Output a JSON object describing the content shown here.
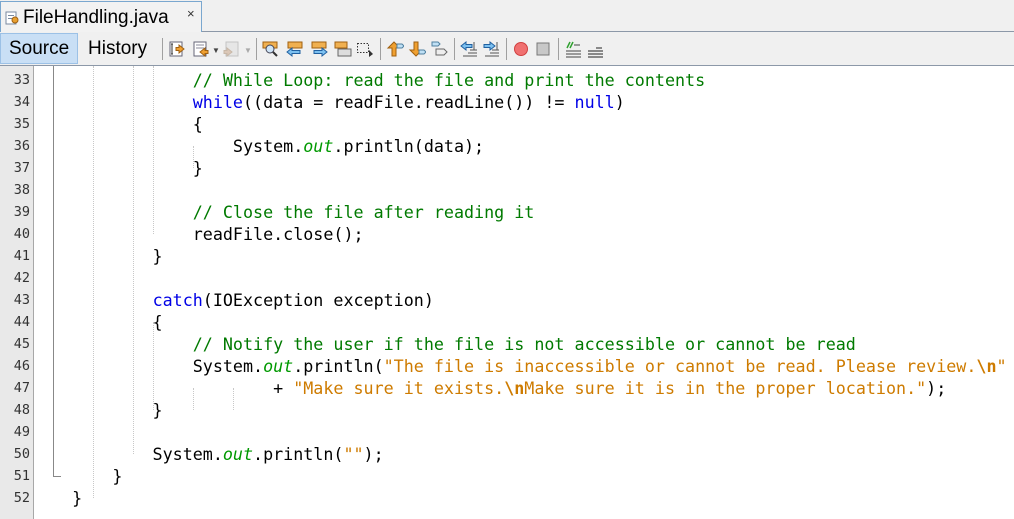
{
  "file_tab": {
    "name": "FileHandling.java",
    "close": "×",
    "icon": "java-file-icon"
  },
  "view_tabs": [
    {
      "label": "Source",
      "active": true
    },
    {
      "label": "History",
      "active": false
    }
  ],
  "toolbar": {
    "icons": [
      "last-edit-icon",
      "back-icon",
      "forward-icon",
      "find-icon",
      "find-previous-icon",
      "find-next-icon",
      "toggle-highlight-icon",
      "toggle-rect-select-icon",
      "previous-bookmark-icon",
      "next-bookmark-icon",
      "toggle-bookmark-icon",
      "shift-left-icon",
      "shift-right-icon",
      "start-macro-icon",
      "stop-macro-icon",
      "comment-icon",
      "uncomment-icon"
    ]
  },
  "colors": {
    "keyword": "#0000e6",
    "comment": "#007a00",
    "string": "#ce7b00",
    "field": "#009900",
    "active_tab": "#c9dff5"
  },
  "editor": {
    "line_numbers": [
      "33",
      "34",
      "35",
      "36",
      "37",
      "38",
      "39",
      "40",
      "41",
      "42",
      "43",
      "44",
      "45",
      "46",
      "47",
      "48",
      "49",
      "50",
      "51",
      "52"
    ],
    "lines": [
      [
        {
          "t": "cm",
          "v": "                // While Loop: read the file and print the contents"
        }
      ],
      [
        {
          "t": "",
          "v": "                "
        },
        {
          "t": "kw",
          "v": "while"
        },
        {
          "t": "",
          "v": "((data = readFile.readLine()) != "
        },
        {
          "t": "kw",
          "v": "null"
        },
        {
          "t": "",
          "v": ")"
        }
      ],
      [
        {
          "t": "",
          "v": "                {"
        }
      ],
      [
        {
          "t": "",
          "v": "                    System."
        },
        {
          "t": "it",
          "v": "out"
        },
        {
          "t": "",
          "v": ".println(data);"
        }
      ],
      [
        {
          "t": "",
          "v": "                }"
        }
      ],
      [
        {
          "t": "",
          "v": ""
        }
      ],
      [
        {
          "t": "cm",
          "v": "                // Close the file after reading it"
        }
      ],
      [
        {
          "t": "",
          "v": "                readFile.close();"
        }
      ],
      [
        {
          "t": "",
          "v": "            }"
        }
      ],
      [
        {
          "t": "",
          "v": ""
        }
      ],
      [
        {
          "t": "",
          "v": "            "
        },
        {
          "t": "kw",
          "v": "catch"
        },
        {
          "t": "",
          "v": "(IOException exception)"
        }
      ],
      [
        {
          "t": "",
          "v": "            {"
        }
      ],
      [
        {
          "t": "cm",
          "v": "                // Notify the user if the file is not accessible or cannot be read"
        }
      ],
      [
        {
          "t": "",
          "v": "                System."
        },
        {
          "t": "it",
          "v": "out"
        },
        {
          "t": "",
          "v": ".println("
        },
        {
          "t": "st",
          "v": "\"The file is inaccessible or cannot be read. Please review."
        },
        {
          "t": "esc",
          "v": "\\n"
        },
        {
          "t": "st",
          "v": "\""
        }
      ],
      [
        {
          "t": "",
          "v": "                        + "
        },
        {
          "t": "st",
          "v": "\"Make sure it exists."
        },
        {
          "t": "esc",
          "v": "\\n"
        },
        {
          "t": "st",
          "v": "Make sure it is in the proper location.\""
        },
        {
          "t": "",
          "v": ");"
        }
      ],
      [
        {
          "t": "",
          "v": "            }"
        }
      ],
      [
        {
          "t": "",
          "v": ""
        }
      ],
      [
        {
          "t": "",
          "v": "            System."
        },
        {
          "t": "it",
          "v": "out"
        },
        {
          "t": "",
          "v": ".println("
        },
        {
          "t": "st",
          "v": "\"\""
        },
        {
          "t": "",
          "v": ");"
        }
      ],
      [
        {
          "t": "",
          "v": "        }"
        }
      ],
      [
        {
          "t": "",
          "v": "    }"
        }
      ]
    ]
  }
}
